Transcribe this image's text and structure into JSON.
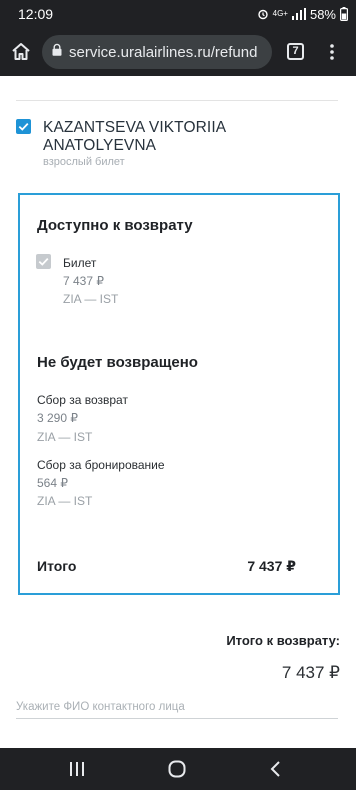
{
  "status_bar": {
    "time": "12:09",
    "network": "4G+",
    "battery": "58%"
  },
  "browser": {
    "url": "service.uralairlines.ru/refund",
    "tab_count": "7"
  },
  "passenger": {
    "name": "KAZANTSEVA VIKTORIIA ANATOLYEVNA",
    "ticket_type": "взрослый билет"
  },
  "refund_panel": {
    "available_title": "Доступно к возврату",
    "ticket": {
      "label": "Билет",
      "amount": "7 437 ₽",
      "route": "ZIA — IST"
    },
    "not_refunded_title": "Не будет возвращено",
    "fees": [
      {
        "label": "Сбор за возврат",
        "amount": "3 290 ₽",
        "route": "ZIA — IST"
      },
      {
        "label": "Сбор за бронирование",
        "amount": "564 ₽",
        "route": "ZIA — IST"
      }
    ],
    "total_label": "Итого",
    "total_value": "7 437 ₽"
  },
  "refund_summary": {
    "label": "Итого к возврату:",
    "value": "7 437 ₽"
  },
  "contact_field": {
    "placeholder": "Укажите ФИО контактного лица",
    "value": ""
  },
  "colors": {
    "accent": "#2a9ed8",
    "checkbox_checked": "#1e93d6",
    "checkbox_disabled": "#c6cace",
    "chrome_dark": "#202124"
  },
  "icons": [
    "home-icon",
    "lock-icon",
    "tabs-icon",
    "more-vert-icon",
    "recent-apps-icon",
    "nav-home-icon",
    "nav-back-icon"
  ]
}
